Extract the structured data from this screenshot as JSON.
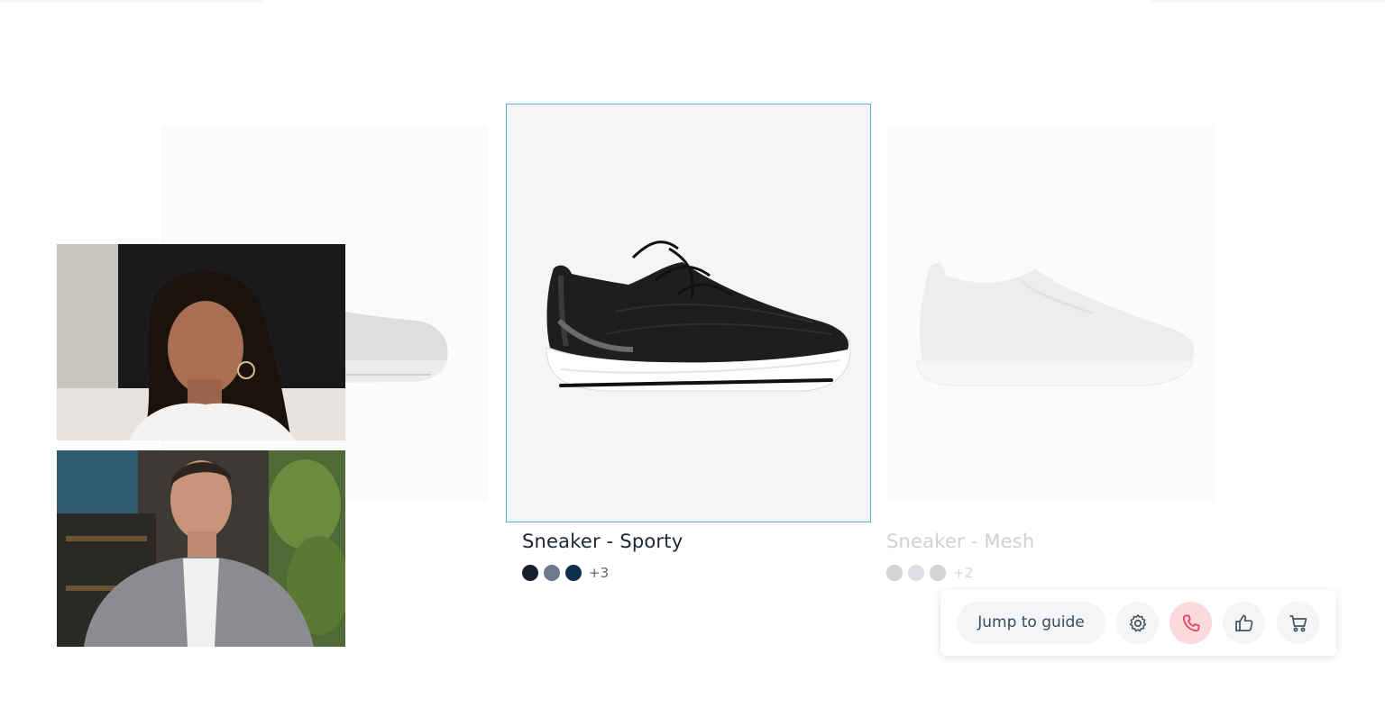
{
  "products": [
    {
      "name": "",
      "state": "faded",
      "swatches": []
    },
    {
      "name": "Sneaker - Sporty",
      "state": "selected",
      "swatches": [
        "#17202e",
        "#6e7a8d",
        "#0e3050"
      ],
      "more_colors": "+3"
    },
    {
      "name": "Sneaker - Mesh",
      "state": "faded",
      "swatches": [
        "#d3d5d8",
        "#dcdee1",
        "#d3d5d9"
      ],
      "more_colors": "+2"
    }
  ],
  "video_call": {
    "participants": [
      {
        "role": "guide"
      },
      {
        "role": "customer"
      }
    ]
  },
  "action_bar": {
    "jump_label": "Jump to guide",
    "icons": [
      "gear-icon",
      "phone-icon",
      "thumbs-up-icon",
      "cart-icon"
    ],
    "call_accent": "#e8455e",
    "call_bg": "#fbd9dc"
  },
  "colors": {
    "selected_border": "#5aaee0",
    "text_primary": "#1d2433",
    "text_faded": "#cfd1d6"
  }
}
